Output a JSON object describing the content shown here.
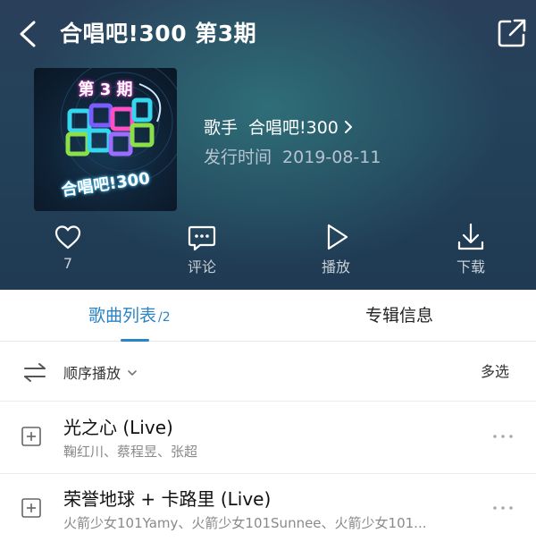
{
  "header": {
    "title": "合唱吧!300 第3期",
    "cover": {
      "episode_text": "第 3 期",
      "brand_text": "合唱吧!300"
    },
    "artist_label": "歌手",
    "artist_name": "合唱吧!300",
    "release_label": "发行时间",
    "release_date": "2019-08-11",
    "actions": {
      "like_count": "7",
      "comment_label": "评论",
      "play_label": "播放",
      "download_label": "下载"
    },
    "icons": {
      "back": "chevron-left-icon",
      "share": "share-external-icon",
      "like": "heart-icon",
      "comment": "comment-bubble-icon",
      "play": "play-triangle-icon",
      "download": "download-icon"
    }
  },
  "tabs": {
    "songs_label": "歌曲列表",
    "songs_count": "/2",
    "info_label": "专辑信息",
    "active": "songs"
  },
  "playbar": {
    "order_label": "顺序播放",
    "multi_select_label": "多选"
  },
  "songs": [
    {
      "title": "光之心 (Live)",
      "artists": "鞠红川、蔡程昱、张超"
    },
    {
      "title": "荣誉地球 + 卡路里 (Live)",
      "artists": "火箭少女101Yamy、火箭少女101Sunnee、火箭少女101..."
    }
  ],
  "colors": {
    "accent": "#2a84c6",
    "header_bg": "#23425a",
    "secondary_text": "#8a8a8a"
  }
}
